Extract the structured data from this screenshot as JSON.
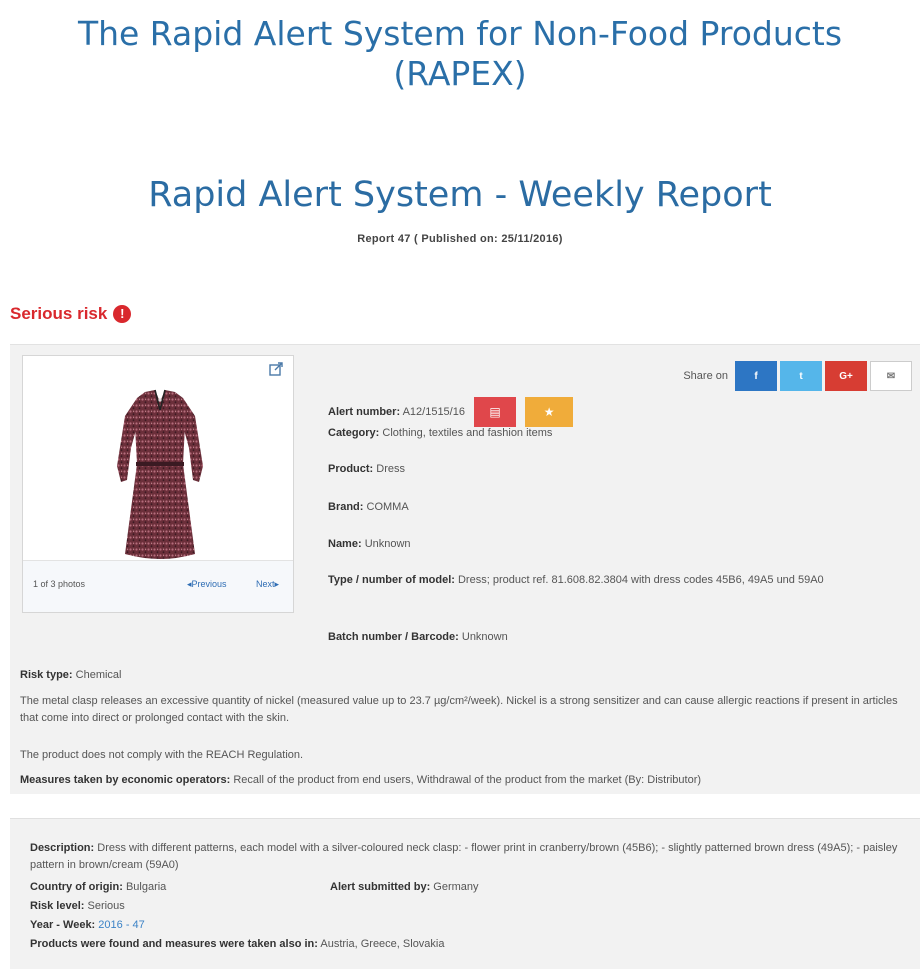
{
  "page": {
    "title_line1": "The Rapid Alert System for Non-Food Products",
    "title_line2": "(RAPEX)",
    "report_title": "Rapid Alert System - Weekly Report",
    "report_subtitle": "Report 47 ( Published on: 25/11/2016)"
  },
  "risk": {
    "heading": "Serious risk",
    "icon": "exclamation-circle-icon",
    "color": "#d9282d"
  },
  "photo": {
    "count_text": "1 of 3 photos",
    "prev_label": "◂Previous",
    "next_label": "Next▸",
    "external_icon": "external-link-icon"
  },
  "share": {
    "label": "Share on",
    "facebook": "f",
    "twitter": "t",
    "google": "G+",
    "email": "✉"
  },
  "alert": {
    "number_label": "Alert number:",
    "number_value": "A12/1515/16",
    "category_label": "Category:",
    "category_value": "Clothing, textiles and fashion items",
    "product_label": "Product:",
    "product_value": "Dress",
    "brand_label": "Brand:",
    "brand_value": "COMMA",
    "name_label": "Name:",
    "name_value": "Unknown",
    "model_label": "Type / number of model:",
    "model_value": "Dress; product ref. 81.608.82.3804 with dress codes 45B6, 49A5 und 59A0",
    "batch_label": "Batch number / Barcode:",
    "batch_value": "Unknown"
  },
  "details": {
    "risk_type_label": "Risk type:",
    "risk_type_value": "Chemical",
    "risk_description": "The metal clasp releases an excessive quantity of nickel (measured value up to 23.7 µg/cm²/week). Nickel is a strong sensitizer and can cause allergic reactions if present in articles that come into direct or prolonged contact with the skin.",
    "compliance": "The product does not comply with the REACH Regulation.",
    "measures_label": "Measures taken by economic operators:",
    "measures_value": "Recall of the product from end users, Withdrawal of the product from the market (By: Distributor)"
  },
  "description": {
    "desc_label": "Description:",
    "desc_value": "Dress with different patterns, each model with a silver-coloured neck clasp: - flower print in cranberry/brown (45B6); - slightly patterned brown dress (49A5); - paisley pattern in brown/cream (59A0)",
    "origin_label": "Country of origin:",
    "origin_value": "Bulgaria",
    "submitted_label": "Alert submitted by:",
    "submitted_value": "Germany",
    "level_label": "Risk level:",
    "level_value": "Serious",
    "week_label": "Year - Week:",
    "week_value": "2016 - 47",
    "found_label": "Products were found and measures were taken also in:",
    "found_value": "Austria, Greece, Slovakia"
  },
  "colors": {
    "title_blue": "#2a6fa8",
    "panel_bg": "#f2f2f2",
    "pdf_red": "#e0474b",
    "star_orange": "#f0ac3a"
  }
}
